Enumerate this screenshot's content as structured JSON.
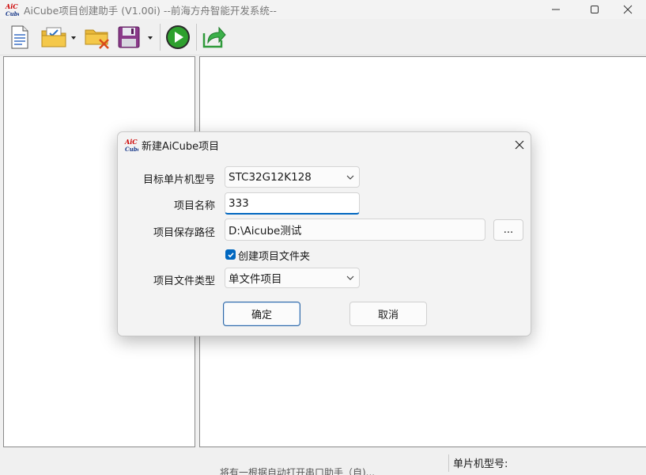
{
  "window": {
    "title": "AiCube项目创建助手 (V1.00i) --前海方舟智能开发系统--",
    "logo_text": "AiC Cube"
  },
  "toolbar": {
    "buttons": [
      "new-document-icon",
      "open-project-icon",
      "close-project-icon",
      "save-icon",
      "run-icon",
      "export-icon"
    ]
  },
  "statusbar": {
    "mcu_label": "单片机型号:",
    "ghost_text": "将有一根据自动打开串口助手（自)..."
  },
  "dialog": {
    "title": "新建AiCube项目",
    "fields": {
      "mcu_label": "目标单片机型号",
      "mcu_value": "STC32G12K128",
      "name_label": "项目名称",
      "name_value": "333",
      "path_label": "项目保存路径",
      "path_value": "D:\\Aicube测试",
      "browse_label": "...",
      "create_folder_label": "创建项目文件夹",
      "create_folder_checked": true,
      "filetype_label": "项目文件类型",
      "filetype_value": "单文件项目"
    },
    "ok_label": "确定",
    "cancel_label": "取消"
  },
  "colors": {
    "accent": "#0067c0",
    "window_bg": "#f0f0f0",
    "dialog_bg": "#f3f3f3"
  }
}
